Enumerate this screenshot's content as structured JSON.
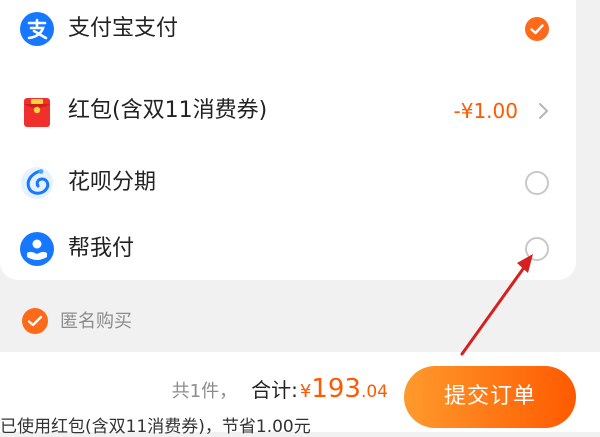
{
  "payment_methods": {
    "alipay": {
      "label": "支付宝支付",
      "selected": true
    },
    "red_packet": {
      "label": "红包(含双11消费券)",
      "amount": "-¥1.00"
    },
    "huabei": {
      "label": "花呗分期",
      "selected": false
    },
    "help_pay": {
      "label": "帮我付",
      "selected": false
    }
  },
  "anonymous": {
    "label": "匿名购买",
    "checked": true
  },
  "summary": {
    "count_text": "共1件，",
    "total_label": "合计:",
    "currency": "¥",
    "total_int": "193",
    "total_dec": ".04",
    "saved_text": "已使用红包(含双11消费券)，节省1.00元"
  },
  "submit_label": "提交订单",
  "colors": {
    "accent": "#ff6a1a",
    "price": "#ff5a00",
    "alipay_blue": "#1677ff",
    "annotation_arrow": "#d62020"
  }
}
